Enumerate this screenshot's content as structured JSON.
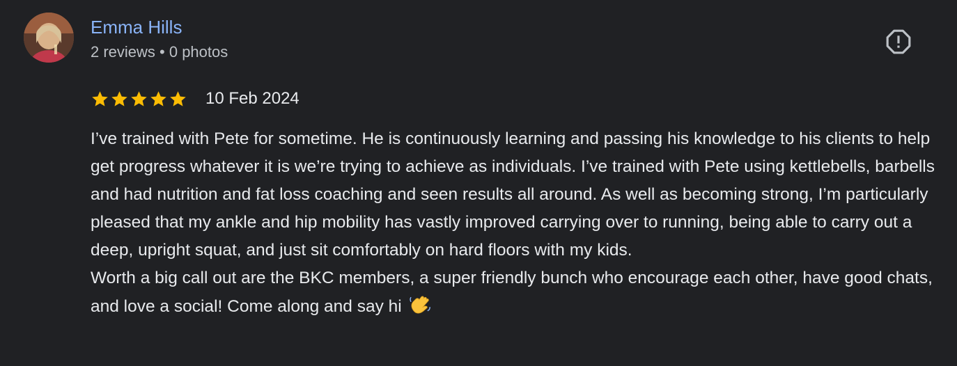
{
  "reviewer": {
    "name": "Emma Hills",
    "meta": "2 reviews • 0 photos"
  },
  "review": {
    "rating": 5,
    "max_rating": 5,
    "date": "10 Feb 2024",
    "paragraph_1": "I’ve trained with Pete for sometime. He is continuously learning and passing his knowledge to his clients to help get progress whatever it is we’re trying to achieve as individuals. I’ve trained with Pete using kettlebells, barbells and had nutrition and fat loss coaching and seen results all around. As well as becoming strong, I’m particularly pleased that my ankle and hip mobility has vastly improved carrying over to running, being able to carry out a deep, upright squat, and just sit comfortably on hard floors with my kids.",
    "paragraph_2": "Worth a big call out are the BKC members, a super friendly bunch who encourage each other, have good chats, and love a social! Come along and say hi",
    "emoji": "waving-hand-icon"
  },
  "icons": {
    "report": "report-icon",
    "star": "star-icon"
  },
  "colors": {
    "background": "#202124",
    "name_link": "#8ab4f8",
    "star": "#fbbc04",
    "text": "#e8eaed",
    "secondary_text": "#bdc1c6"
  }
}
